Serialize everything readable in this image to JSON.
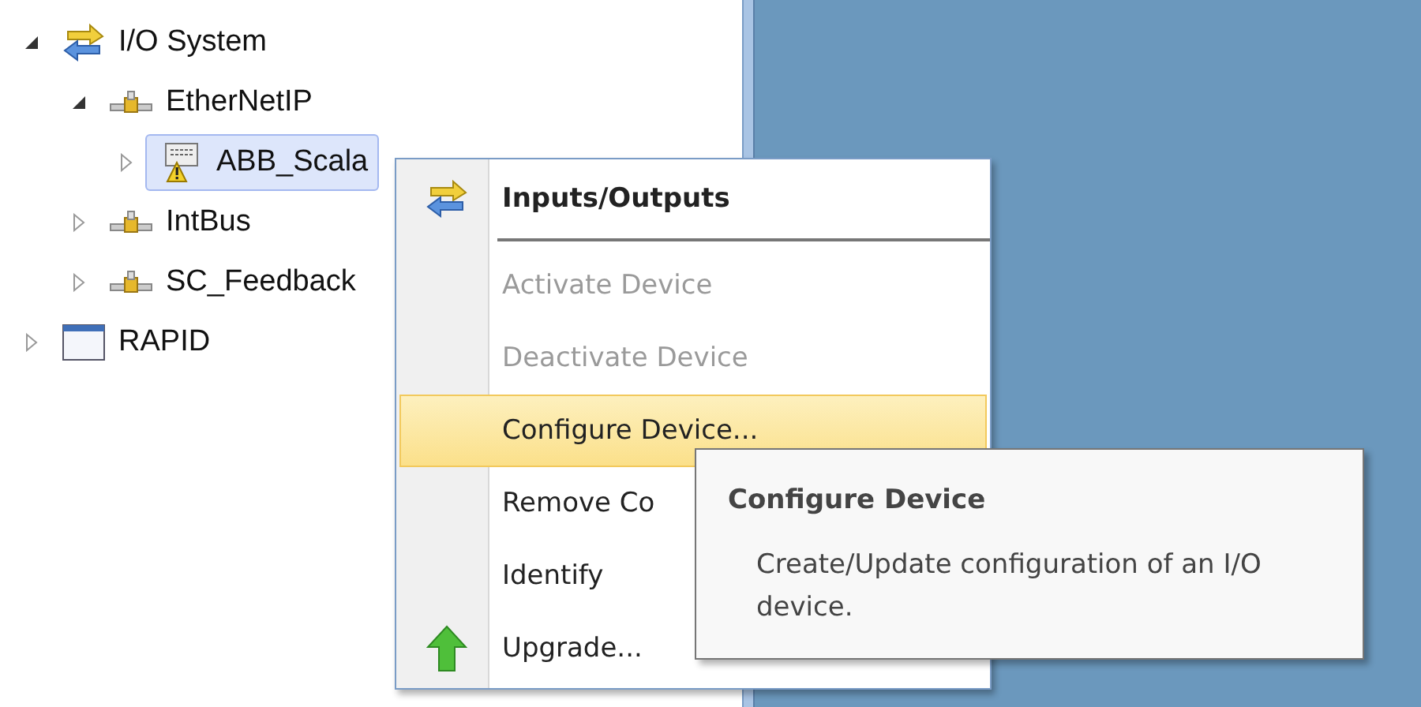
{
  "tree": [
    {
      "label": "I/O System",
      "kind": "io",
      "expanded": true,
      "selected": false,
      "children": [
        {
          "label": "EtherNetIP",
          "kind": "bus",
          "expanded": true,
          "selected": false,
          "children": [
            {
              "label": "ABB_Scala",
              "kind": "device",
              "expanded": false,
              "selected": true
            }
          ]
        },
        {
          "label": "IntBus",
          "kind": "bus",
          "expanded": false,
          "selected": false
        },
        {
          "label": "SC_Feedback",
          "kind": "bus",
          "expanded": false,
          "selected": false
        }
      ]
    },
    {
      "label": "RAPID",
      "kind": "module",
      "expanded": false,
      "selected": false
    }
  ],
  "context_menu": [
    {
      "label": "Inputs/Outputs",
      "kind": "io",
      "default": true,
      "disabled": false,
      "selected": false,
      "separator_after": true
    },
    {
      "label": "Activate Device",
      "default": false,
      "disabled": true,
      "selected": false
    },
    {
      "label": "Deactivate Device",
      "default": false,
      "disabled": true,
      "selected": false
    },
    {
      "label": "Configure Device...",
      "default": false,
      "disabled": false,
      "selected": true
    },
    {
      "label": "Remove Co",
      "default": false,
      "disabled": false,
      "selected": false
    },
    {
      "label": "Identify",
      "default": false,
      "disabled": false,
      "selected": false
    },
    {
      "label": "Upgrade...",
      "kind": "upgrade",
      "default": false,
      "disabled": false,
      "selected": false
    }
  ],
  "tooltip": {
    "title": "Configure Device",
    "text": "Create/Update configuration of an I/O device."
  }
}
